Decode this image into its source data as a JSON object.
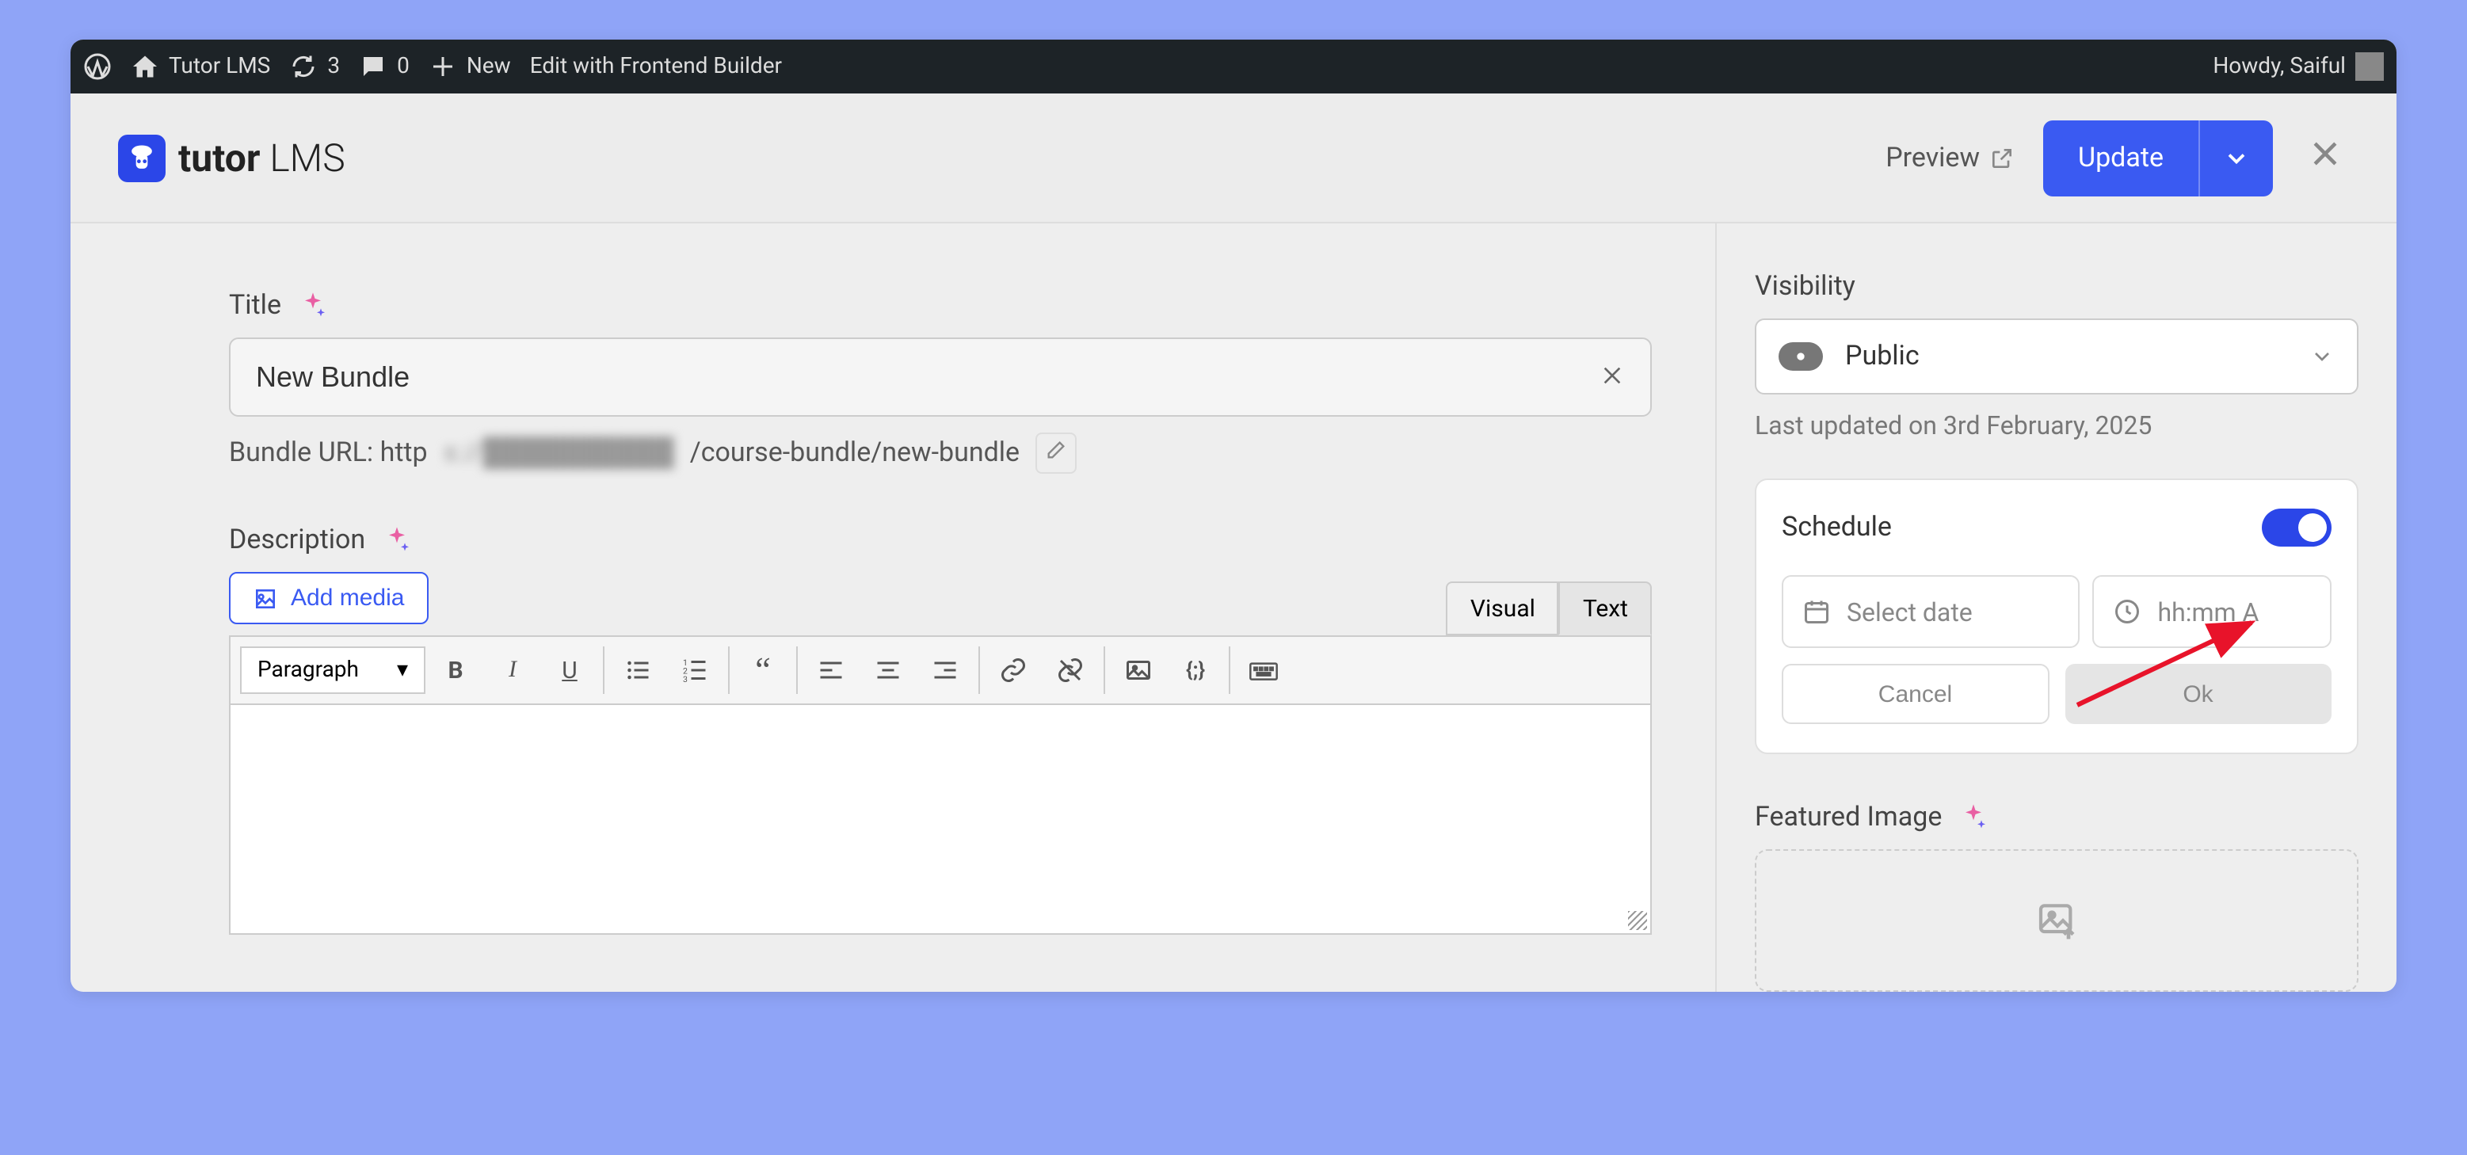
{
  "adminbar": {
    "site_name": "Tutor LMS",
    "refresh_count": "3",
    "comments_count": "0",
    "new_label": "New",
    "frontend_builder": "Edit with Frontend Builder",
    "greeting": "Howdy, Saiful"
  },
  "topbar": {
    "logo_bold": "tutor",
    "logo_light": "LMS",
    "preview": "Preview",
    "update": "Update"
  },
  "main": {
    "title_label": "Title",
    "title_value": "New Bundle",
    "url_prefix": "Bundle URL: http",
    "url_blurred": "s://██████████",
    "url_suffix": "/course-bundle/new-bundle",
    "description_label": "Description",
    "add_media": "Add media",
    "tabs": {
      "visual": "Visual",
      "text": "Text"
    },
    "format_select": "Paragraph"
  },
  "sidebar": {
    "visibility_label": "Visibility",
    "visibility_value": "Public",
    "last_updated": "Last updated on 3rd February, 2025",
    "schedule": {
      "label": "Schedule",
      "date_placeholder": "Select date",
      "time_placeholder": "hh:mm A",
      "cancel": "Cancel",
      "ok": "Ok"
    },
    "featured_label": "Featured Image"
  }
}
